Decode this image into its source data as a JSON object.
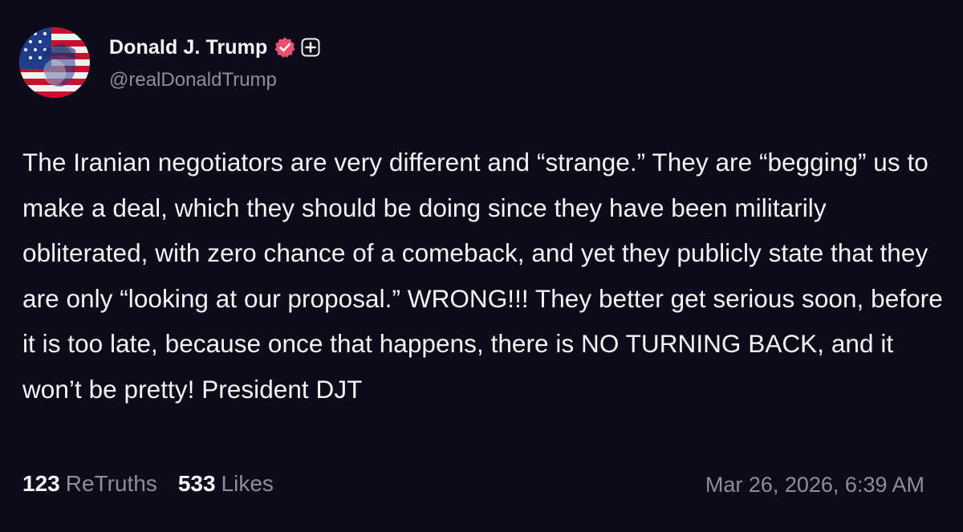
{
  "post": {
    "author": {
      "display_name": "Donald J. Trump",
      "handle": "@realDonaldTrump",
      "verified_icon": "verified-badge-icon",
      "plus_icon": "plus-icon",
      "verified_color": "#e8506b"
    },
    "body": "The Iranian negotiators are very different and “strange.” They are “begging” us to make a deal, which they should be doing since they have been militarily obliterated, with zero chance of a comeback, and yet they publicly state that they are only “looking at our proposal.” WRONG!!! They better get serious soon, before it is too late, because once that happens, there is NO TURNING BACK, and it won’t be pretty! President DJT",
    "stats": {
      "retruths_count": "123",
      "retruths_label": "ReTruths",
      "likes_count": "533",
      "likes_label": "Likes"
    },
    "timestamp": "Mar 26, 2026, 6:39 AM"
  },
  "colors": {
    "background": "#0c0b1a",
    "text_primary": "#f4f4f6",
    "text_secondary": "#8f8d9c"
  }
}
